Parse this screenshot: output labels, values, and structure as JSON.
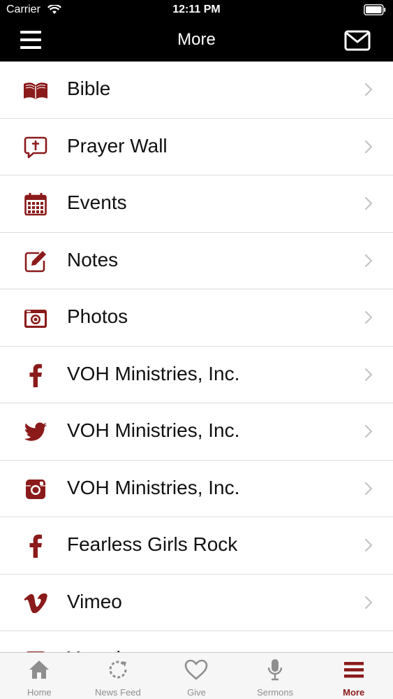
{
  "status": {
    "carrier": "Carrier",
    "time": "12:11 PM"
  },
  "header": {
    "title": "More"
  },
  "colors": {
    "accent": "#8b1a1a",
    "topbar": "#000000",
    "inactive": "#8e8e8e"
  },
  "menu": [
    {
      "label": "Bible",
      "icon": "bible-icon"
    },
    {
      "label": "Prayer Wall",
      "icon": "prayer-wall-icon"
    },
    {
      "label": "Events",
      "icon": "calendar-icon"
    },
    {
      "label": "Notes",
      "icon": "notes-edit-icon"
    },
    {
      "label": "Photos",
      "icon": "camera-icon"
    },
    {
      "label": "VOH Ministries, Inc.",
      "icon": "facebook-icon"
    },
    {
      "label": "VOH Ministries, Inc.",
      "icon": "twitter-icon"
    },
    {
      "label": "VOH Ministries, Inc.",
      "icon": "instagram-icon"
    },
    {
      "label": "Fearless Girls Rock",
      "icon": "facebook-icon"
    },
    {
      "label": "Vimeo",
      "icon": "vimeo-icon"
    },
    {
      "label": "Youtube",
      "icon": "youtube-icon"
    }
  ],
  "tabs": [
    {
      "label": "Home",
      "icon": "home-icon",
      "active": false
    },
    {
      "label": "News Feed",
      "icon": "refresh-icon",
      "active": false
    },
    {
      "label": "Give",
      "icon": "heart-icon",
      "active": false
    },
    {
      "label": "Sermons",
      "icon": "microphone-icon",
      "active": false
    },
    {
      "label": "More",
      "icon": "menu-icon",
      "active": true
    }
  ]
}
